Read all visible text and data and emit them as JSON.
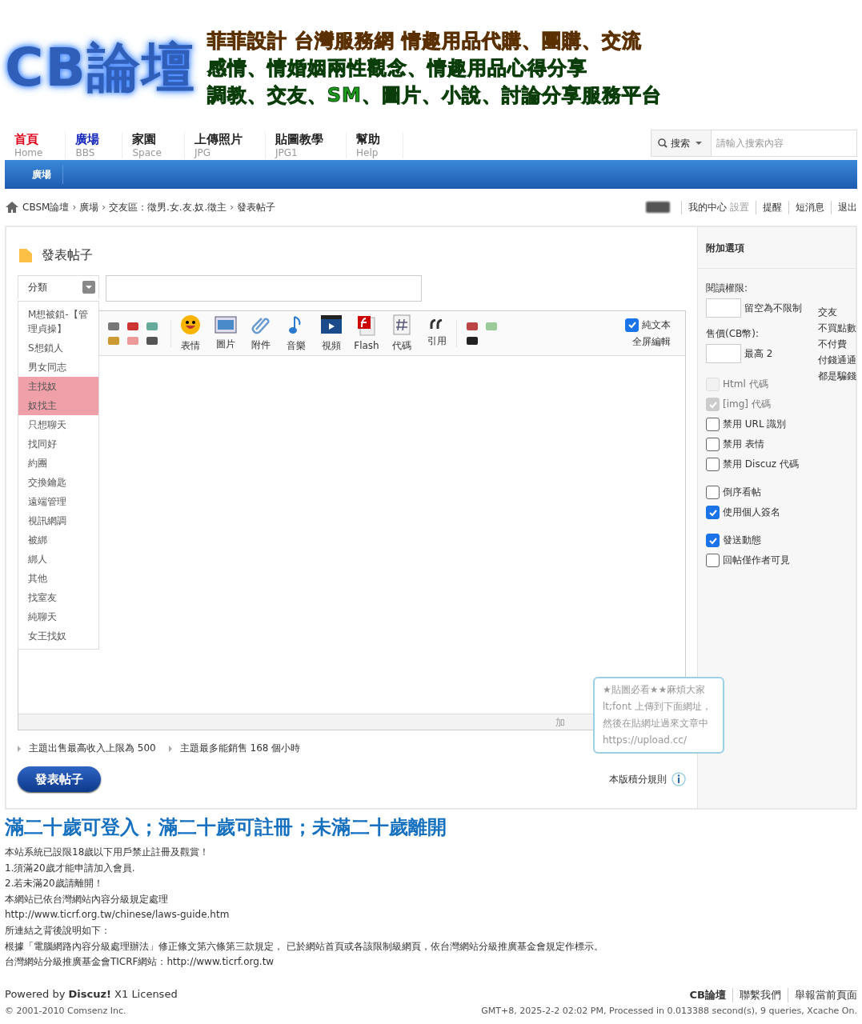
{
  "logo": {
    "title": "CB論壇",
    "slogans": [
      "菲菲設計  台灣服務網  情趣用品代購、團購、交流",
      "感情、情婚姻兩性觀念、情趣用品心得分享",
      "調教、交友、SM、圖片、小說、討論分享服務平台"
    ]
  },
  "nav": {
    "items": [
      {
        "label": "首頁",
        "sub": "Home",
        "color": "#e0001b"
      },
      {
        "label": "廣場",
        "sub": "BBS",
        "color": "#1122bb"
      },
      {
        "label": "家園",
        "sub": "Space",
        "color": "#222222"
      },
      {
        "label": "上傳照片",
        "sub": "JPG",
        "color": "#222222"
      },
      {
        "label": "貼圖教學",
        "sub": "JPG1",
        "color": "#222222"
      },
      {
        "label": "幫助",
        "sub": "Help",
        "color": "#222222"
      }
    ],
    "search": {
      "button": "搜索",
      "placeholder": "請輸入搜索內容"
    }
  },
  "subnav": {
    "items": [
      {
        "label": "廣場",
        "selected": true
      }
    ]
  },
  "breadcrumb": [
    "CBSM論壇",
    "廣場",
    "交友區：徵男.女.友.奴.徵主",
    "發表帖子"
  ],
  "breadcrumb_separator": "›",
  "user_links": [
    {
      "label": "我的中心",
      "extra": "設置"
    },
    {
      "label": "提醒"
    },
    {
      "label": "短消息"
    },
    {
      "label": "退出"
    }
  ],
  "post": {
    "title": "發表帖子",
    "category": {
      "label": "分類",
      "expanded": true,
      "options": [
        {
          "label": "M想被鎖-【管理貞操】",
          "selected": false
        },
        {
          "label": "S想鎖人",
          "selected": false
        },
        {
          "label": "男女同志",
          "selected": false
        },
        {
          "label": "主找奴",
          "selected": true
        },
        {
          "label": "奴找主",
          "selected": true
        },
        {
          "label": "只想聊天",
          "selected": false
        },
        {
          "label": "找同好",
          "selected": false
        },
        {
          "label": "約團",
          "selected": false
        },
        {
          "label": "交換鑰匙",
          "selected": false
        },
        {
          "label": "遠端管理",
          "selected": false
        },
        {
          "label": "視訊網調",
          "selected": false
        },
        {
          "label": "被綁",
          "selected": false
        },
        {
          "label": "綁人",
          "selected": false
        },
        {
          "label": "其他",
          "selected": false
        },
        {
          "label": "找室友",
          "selected": false
        },
        {
          "label": "純聊天",
          "selected": false
        },
        {
          "label": "女王找奴",
          "selected": false
        }
      ]
    },
    "toolbar": {
      "buttons": [
        {
          "kind": "smile",
          "label": "表情"
        },
        {
          "kind": "image",
          "label": "圖片"
        },
        {
          "kind": "clip",
          "label": "附件"
        },
        {
          "kind": "note",
          "label": "音樂"
        },
        {
          "kind": "film",
          "label": "視頻"
        },
        {
          "kind": "flash",
          "label": "Flash"
        },
        {
          "kind": "code",
          "label": "代碼"
        },
        {
          "kind": "quote",
          "label": "引用"
        }
      ],
      "plain_text": {
        "label": "純文本",
        "checked": true
      },
      "fullscreen": "全屏編輯"
    },
    "status_text": "加",
    "notes": [
      "主題出售最高收入上限為 500",
      "主題最多能銷售 168 個小時"
    ],
    "submit": "發表帖子",
    "rules_link": "本版積分規則",
    "tooltip": [
      "★貼圖必看★★麻煩大家",
      "lt;font 上傳到下面網址，",
      "然後在貼網址過來文章中",
      "https://upload.cc/"
    ]
  },
  "sidebar": {
    "title": "附加選項",
    "read_perm": {
      "label": "閱讀權限:",
      "hint": "留空為不限制"
    },
    "price": {
      "label": "售價(CB幣):",
      "hint": "最高 2"
    },
    "side_note": [
      "交友",
      "不買點數",
      "不付費",
      "付錢通通",
      "都是騙錢"
    ],
    "option_groups": [
      [
        {
          "label": "Html 代碼",
          "checked": false,
          "disabled": true
        },
        {
          "label": "[img] 代碼",
          "checked": true,
          "disabled": true
        },
        {
          "label": "禁用 URL 識別",
          "checked": false,
          "disabled": false
        },
        {
          "label": "禁用 表情",
          "checked": false,
          "disabled": false
        },
        {
          "label": "禁用 Discuz 代碼",
          "checked": false,
          "disabled": false
        }
      ],
      [
        {
          "label": "倒序看帖",
          "checked": false,
          "disabled": false
        },
        {
          "label": "使用個人簽名",
          "checked": true,
          "disabled": false
        }
      ],
      [
        {
          "label": "發送動態",
          "checked": true,
          "disabled": false
        },
        {
          "label": "回帖僅作者可見",
          "checked": false,
          "disabled": false
        }
      ]
    ]
  },
  "notice": {
    "heading": "滿二十歲可登入；滿二十歲可註冊；未滿二十歲離開",
    "lines": [
      "本站系統已設限18歲以下用戶禁止註冊及觀賞！",
      "1.須滿20歲才能申請加入會員.",
      "2.若未滿20歲請離開！",
      "本網站已依台灣網站內容分級規定處理",
      "http://www.ticrf.org.tw/chinese/laws-guide.htm",
      "所連結之背後說明如下：",
      "根據「電腦網路內容分級處理辦法」修正條文第六條第三款規定， 已於網站首頁或各該限制級網頁，依台灣網站分級推廣基金會規定作標示。",
      "台灣網站分級推廣基金會TICRF網站：http://www.ticrf.org.tw"
    ]
  },
  "footer": {
    "powered": "Powered by **Discuz!** X1 Licensed",
    "copyright": "© 2001-2010 Comsenz Inc.",
    "links": [
      "CB論壇",
      "聯繫我們",
      "舉報當前頁面"
    ],
    "stats": "GMT+8, 2025-2-2 02:02 PM, Processed in 0.013388 second(s), 9 queries, Xcache On."
  }
}
